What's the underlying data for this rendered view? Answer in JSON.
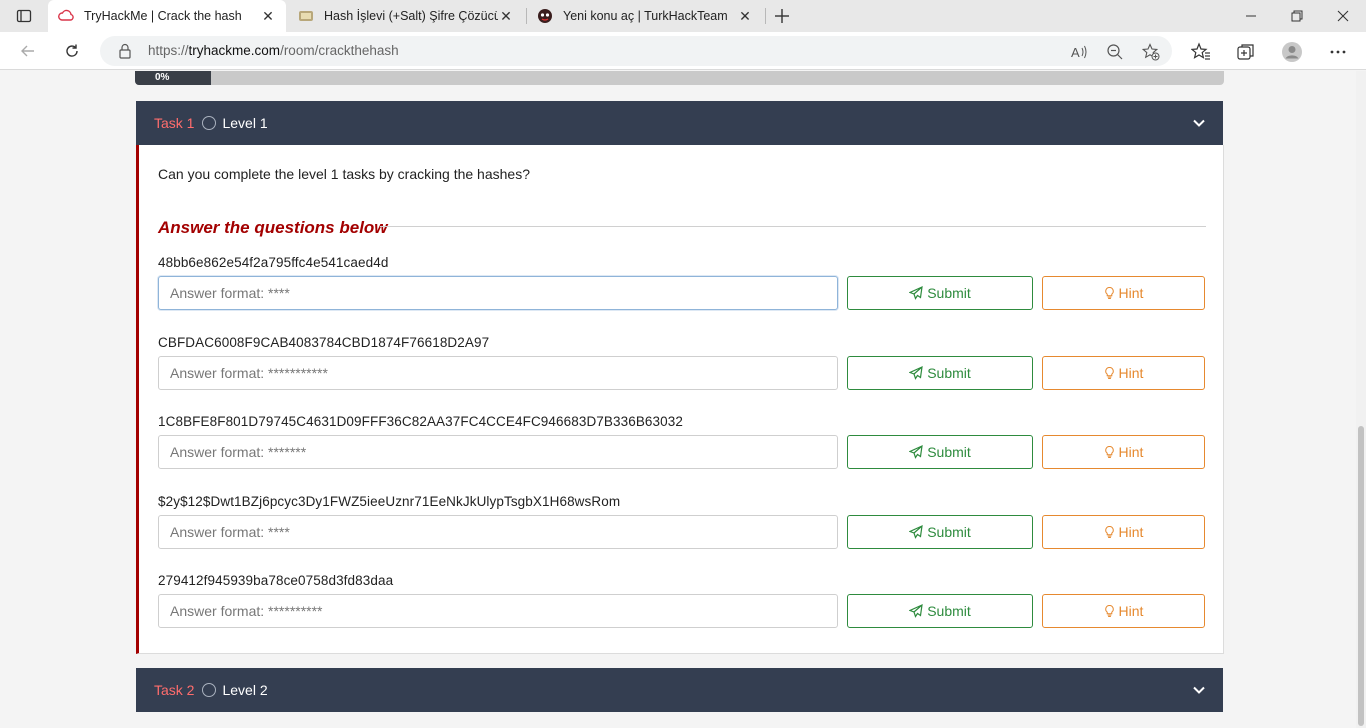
{
  "browser": {
    "tabs": [
      {
        "title": "TryHackMe | Crack the hash",
        "active": true
      },
      {
        "title": "Hash İşlevi (+Salt) Şifre Çözücü -",
        "active": false
      },
      {
        "title": "Yeni konu aç | TurkHackTeam",
        "active": false
      }
    ],
    "url_scheme": "https://",
    "url_domain": "tryhackme.com",
    "url_path": "/room/crackthehash"
  },
  "progress": {
    "label": "0%",
    "value": 0.07
  },
  "tasks": [
    {
      "label": "Task 1",
      "title": "Level 1",
      "intro": "Can you complete the level 1 tasks by cracking the hashes?",
      "answer_heading": "Answer the questions below",
      "questions": [
        {
          "hash": "48bb6e862e54f2a795ffc4e541caed4d",
          "placeholder": "Answer format: ****"
        },
        {
          "hash": "CBFDAC6008F9CAB4083784CBD1874F76618D2A97",
          "placeholder": "Answer format: ***********"
        },
        {
          "hash": "1C8BFE8F801D79745C4631D09FFF36C82AA37FC4CCE4FC946683D7B336B63032",
          "placeholder": "Answer format: *******"
        },
        {
          "hash": "$2y$12$Dwt1BZj6pcyc3Dy1FWZ5ieeUznr71EeNkJkUlypTsgbX1H68wsRom",
          "placeholder": "Answer format: ****"
        },
        {
          "hash": "279412f945939ba78ce0758d3fd83daa",
          "placeholder": "Answer format: **********"
        }
      ]
    },
    {
      "label": "Task 2",
      "title": "Level 2"
    }
  ],
  "buttons": {
    "submit": "Submit",
    "hint": "Hint"
  },
  "colors": {
    "task_header": "#343e51",
    "accent_red": "#a30000",
    "submit_green": "#2e8b3e",
    "hint_orange": "#e6892f"
  }
}
